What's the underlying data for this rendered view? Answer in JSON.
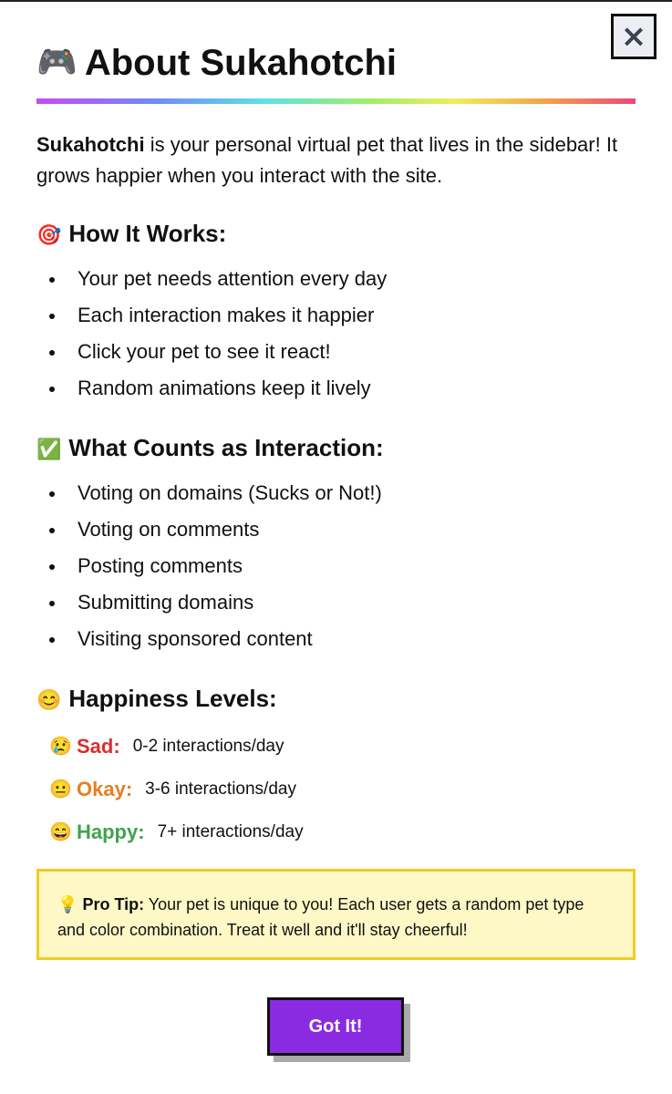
{
  "modal": {
    "close_label": "×",
    "title": {
      "emoji": "🎮",
      "text": "About Sukahotchi"
    },
    "intro": {
      "name": "Sukahotchi",
      "text": " is your personal virtual pet that lives in the sidebar! It grows happier when you interact with the site."
    },
    "how_it_works": {
      "emoji": "🎯",
      "heading": "How It Works:",
      "items": [
        "Your pet needs attention every day",
        "Each interaction makes it happier",
        "Click your pet to see it react!",
        "Random animations keep it lively"
      ]
    },
    "interactions": {
      "emoji": "✅",
      "heading": "What Counts as Interaction:",
      "items": [
        "Voting on domains (Sucks or Not!)",
        "Voting on comments",
        "Posting comments",
        "Submitting domains",
        "Visiting sponsored content"
      ]
    },
    "happiness": {
      "emoji": "😊",
      "heading": "Happiness Levels:",
      "levels": [
        {
          "emoji": "😢",
          "name": "Sad:",
          "desc": "0-2 interactions/day",
          "color": "#d63031"
        },
        {
          "emoji": "😐",
          "name": "Okay:",
          "desc": "3-6 interactions/day",
          "color": "#e67e22"
        },
        {
          "emoji": "😄",
          "name": "Happy:",
          "desc": "7+ interactions/day",
          "color": "#3fa34d"
        }
      ]
    },
    "tip": {
      "emoji": "💡",
      "label": "Pro Tip:",
      "text": " Your pet is unique to you! Each user gets a random pet type and color combination. Treat it well and it'll stay cheerful!"
    },
    "got_it_label": "Got It!"
  },
  "colors": {
    "accent_button": "#8a2be2",
    "tip_border": "#f1cc23",
    "tip_background": "#fdf8c6"
  }
}
